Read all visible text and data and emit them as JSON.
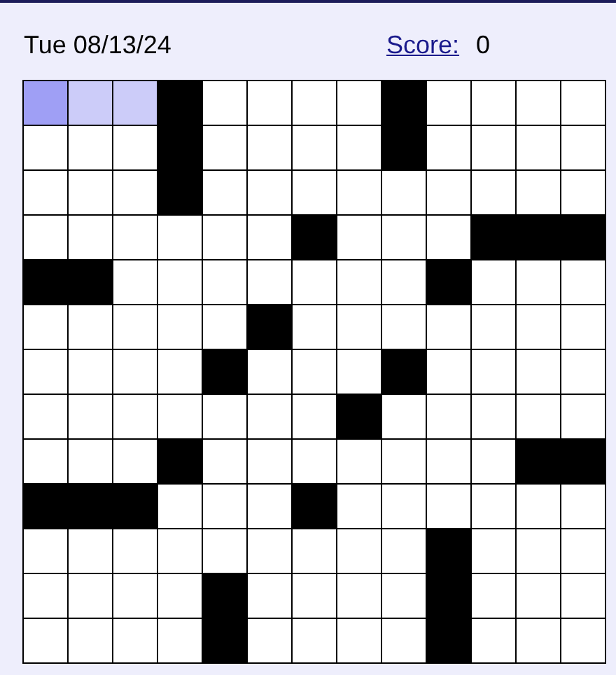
{
  "header": {
    "date": "Tue 08/13/24",
    "score_label": "Score:",
    "score": "0"
  },
  "grid": {
    "rows": [
      {
        "cells": [
          {
            "kind": "open",
            "selected": true,
            "in_word": true
          },
          {
            "kind": "open",
            "selected": false,
            "in_word": true
          },
          {
            "kind": "open",
            "selected": false,
            "in_word": true
          },
          {
            "kind": "block"
          },
          {
            "kind": "open",
            "selected": false,
            "in_word": false
          },
          {
            "kind": "open",
            "selected": false,
            "in_word": false
          },
          {
            "kind": "open",
            "selected": false,
            "in_word": false
          },
          {
            "kind": "open",
            "selected": false,
            "in_word": false
          },
          {
            "kind": "block"
          },
          {
            "kind": "open",
            "selected": false,
            "in_word": false
          },
          {
            "kind": "open",
            "selected": false,
            "in_word": false
          },
          {
            "kind": "open",
            "selected": false,
            "in_word": false
          },
          {
            "kind": "open",
            "selected": false,
            "in_word": false
          }
        ]
      },
      {
        "cells": [
          {
            "kind": "open",
            "selected": false,
            "in_word": false
          },
          {
            "kind": "open",
            "selected": false,
            "in_word": false
          },
          {
            "kind": "open",
            "selected": false,
            "in_word": false
          },
          {
            "kind": "block"
          },
          {
            "kind": "open",
            "selected": false,
            "in_word": false
          },
          {
            "kind": "open",
            "selected": false,
            "in_word": false
          },
          {
            "kind": "open",
            "selected": false,
            "in_word": false
          },
          {
            "kind": "open",
            "selected": false,
            "in_word": false
          },
          {
            "kind": "block"
          },
          {
            "kind": "open",
            "selected": false,
            "in_word": false
          },
          {
            "kind": "open",
            "selected": false,
            "in_word": false
          },
          {
            "kind": "open",
            "selected": false,
            "in_word": false
          },
          {
            "kind": "open",
            "selected": false,
            "in_word": false
          }
        ]
      },
      {
        "cells": [
          {
            "kind": "open",
            "selected": false,
            "in_word": false
          },
          {
            "kind": "open",
            "selected": false,
            "in_word": false
          },
          {
            "kind": "open",
            "selected": false,
            "in_word": false
          },
          {
            "kind": "block"
          },
          {
            "kind": "open",
            "selected": false,
            "in_word": false
          },
          {
            "kind": "open",
            "selected": false,
            "in_word": false
          },
          {
            "kind": "open",
            "selected": false,
            "in_word": false
          },
          {
            "kind": "open",
            "selected": false,
            "in_word": false
          },
          {
            "kind": "open",
            "selected": false,
            "in_word": false
          },
          {
            "kind": "open",
            "selected": false,
            "in_word": false
          },
          {
            "kind": "open",
            "selected": false,
            "in_word": false
          },
          {
            "kind": "open",
            "selected": false,
            "in_word": false
          },
          {
            "kind": "open",
            "selected": false,
            "in_word": false
          }
        ]
      },
      {
        "cells": [
          {
            "kind": "open",
            "selected": false,
            "in_word": false
          },
          {
            "kind": "open",
            "selected": false,
            "in_word": false
          },
          {
            "kind": "open",
            "selected": false,
            "in_word": false
          },
          {
            "kind": "open",
            "selected": false,
            "in_word": false
          },
          {
            "kind": "open",
            "selected": false,
            "in_word": false
          },
          {
            "kind": "open",
            "selected": false,
            "in_word": false
          },
          {
            "kind": "block"
          },
          {
            "kind": "open",
            "selected": false,
            "in_word": false
          },
          {
            "kind": "open",
            "selected": false,
            "in_word": false
          },
          {
            "kind": "open",
            "selected": false,
            "in_word": false
          },
          {
            "kind": "block"
          },
          {
            "kind": "block"
          },
          {
            "kind": "block"
          }
        ]
      },
      {
        "cells": [
          {
            "kind": "block"
          },
          {
            "kind": "block"
          },
          {
            "kind": "open",
            "selected": false,
            "in_word": false
          },
          {
            "kind": "open",
            "selected": false,
            "in_word": false
          },
          {
            "kind": "open",
            "selected": false,
            "in_word": false
          },
          {
            "kind": "open",
            "selected": false,
            "in_word": false
          },
          {
            "kind": "open",
            "selected": false,
            "in_word": false
          },
          {
            "kind": "open",
            "selected": false,
            "in_word": false
          },
          {
            "kind": "open",
            "selected": false,
            "in_word": false
          },
          {
            "kind": "block"
          },
          {
            "kind": "open",
            "selected": false,
            "in_word": false
          },
          {
            "kind": "open",
            "selected": false,
            "in_word": false
          },
          {
            "kind": "open",
            "selected": false,
            "in_word": false
          }
        ]
      },
      {
        "cells": [
          {
            "kind": "open",
            "selected": false,
            "in_word": false
          },
          {
            "kind": "open",
            "selected": false,
            "in_word": false
          },
          {
            "kind": "open",
            "selected": false,
            "in_word": false
          },
          {
            "kind": "open",
            "selected": false,
            "in_word": false
          },
          {
            "kind": "open",
            "selected": false,
            "in_word": false
          },
          {
            "kind": "block"
          },
          {
            "kind": "open",
            "selected": false,
            "in_word": false
          },
          {
            "kind": "open",
            "selected": false,
            "in_word": false
          },
          {
            "kind": "open",
            "selected": false,
            "in_word": false
          },
          {
            "kind": "open",
            "selected": false,
            "in_word": false
          },
          {
            "kind": "open",
            "selected": false,
            "in_word": false
          },
          {
            "kind": "open",
            "selected": false,
            "in_word": false
          },
          {
            "kind": "open",
            "selected": false,
            "in_word": false
          }
        ]
      },
      {
        "cells": [
          {
            "kind": "open",
            "selected": false,
            "in_word": false
          },
          {
            "kind": "open",
            "selected": false,
            "in_word": false
          },
          {
            "kind": "open",
            "selected": false,
            "in_word": false
          },
          {
            "kind": "open",
            "selected": false,
            "in_word": false
          },
          {
            "kind": "block"
          },
          {
            "kind": "open",
            "selected": false,
            "in_word": false
          },
          {
            "kind": "open",
            "selected": false,
            "in_word": false
          },
          {
            "kind": "open",
            "selected": false,
            "in_word": false
          },
          {
            "kind": "block"
          },
          {
            "kind": "open",
            "selected": false,
            "in_word": false
          },
          {
            "kind": "open",
            "selected": false,
            "in_word": false
          },
          {
            "kind": "open",
            "selected": false,
            "in_word": false
          },
          {
            "kind": "open",
            "selected": false,
            "in_word": false
          }
        ]
      },
      {
        "cells": [
          {
            "kind": "open",
            "selected": false,
            "in_word": false
          },
          {
            "kind": "open",
            "selected": false,
            "in_word": false
          },
          {
            "kind": "open",
            "selected": false,
            "in_word": false
          },
          {
            "kind": "open",
            "selected": false,
            "in_word": false
          },
          {
            "kind": "open",
            "selected": false,
            "in_word": false
          },
          {
            "kind": "open",
            "selected": false,
            "in_word": false
          },
          {
            "kind": "open",
            "selected": false,
            "in_word": false
          },
          {
            "kind": "block"
          },
          {
            "kind": "open",
            "selected": false,
            "in_word": false
          },
          {
            "kind": "open",
            "selected": false,
            "in_word": false
          },
          {
            "kind": "open",
            "selected": false,
            "in_word": false
          },
          {
            "kind": "open",
            "selected": false,
            "in_word": false
          },
          {
            "kind": "open",
            "selected": false,
            "in_word": false
          }
        ]
      },
      {
        "cells": [
          {
            "kind": "open",
            "selected": false,
            "in_word": false
          },
          {
            "kind": "open",
            "selected": false,
            "in_word": false
          },
          {
            "kind": "open",
            "selected": false,
            "in_word": false
          },
          {
            "kind": "block"
          },
          {
            "kind": "open",
            "selected": false,
            "in_word": false
          },
          {
            "kind": "open",
            "selected": false,
            "in_word": false
          },
          {
            "kind": "open",
            "selected": false,
            "in_word": false
          },
          {
            "kind": "open",
            "selected": false,
            "in_word": false
          },
          {
            "kind": "open",
            "selected": false,
            "in_word": false
          },
          {
            "kind": "open",
            "selected": false,
            "in_word": false
          },
          {
            "kind": "open",
            "selected": false,
            "in_word": false
          },
          {
            "kind": "block"
          },
          {
            "kind": "block"
          }
        ]
      },
      {
        "cells": [
          {
            "kind": "block"
          },
          {
            "kind": "block"
          },
          {
            "kind": "block"
          },
          {
            "kind": "open",
            "selected": false,
            "in_word": false
          },
          {
            "kind": "open",
            "selected": false,
            "in_word": false
          },
          {
            "kind": "open",
            "selected": false,
            "in_word": false
          },
          {
            "kind": "block"
          },
          {
            "kind": "open",
            "selected": false,
            "in_word": false
          },
          {
            "kind": "open",
            "selected": false,
            "in_word": false
          },
          {
            "kind": "open",
            "selected": false,
            "in_word": false
          },
          {
            "kind": "open",
            "selected": false,
            "in_word": false
          },
          {
            "kind": "open",
            "selected": false,
            "in_word": false
          },
          {
            "kind": "open",
            "selected": false,
            "in_word": false
          }
        ]
      },
      {
        "cells": [
          {
            "kind": "open",
            "selected": false,
            "in_word": false
          },
          {
            "kind": "open",
            "selected": false,
            "in_word": false
          },
          {
            "kind": "open",
            "selected": false,
            "in_word": false
          },
          {
            "kind": "open",
            "selected": false,
            "in_word": false
          },
          {
            "kind": "open",
            "selected": false,
            "in_word": false
          },
          {
            "kind": "open",
            "selected": false,
            "in_word": false
          },
          {
            "kind": "open",
            "selected": false,
            "in_word": false
          },
          {
            "kind": "open",
            "selected": false,
            "in_word": false
          },
          {
            "kind": "open",
            "selected": false,
            "in_word": false
          },
          {
            "kind": "block"
          },
          {
            "kind": "open",
            "selected": false,
            "in_word": false
          },
          {
            "kind": "open",
            "selected": false,
            "in_word": false
          },
          {
            "kind": "open",
            "selected": false,
            "in_word": false
          }
        ]
      },
      {
        "cells": [
          {
            "kind": "open",
            "selected": false,
            "in_word": false
          },
          {
            "kind": "open",
            "selected": false,
            "in_word": false
          },
          {
            "kind": "open",
            "selected": false,
            "in_word": false
          },
          {
            "kind": "open",
            "selected": false,
            "in_word": false
          },
          {
            "kind": "block"
          },
          {
            "kind": "open",
            "selected": false,
            "in_word": false
          },
          {
            "kind": "open",
            "selected": false,
            "in_word": false
          },
          {
            "kind": "open",
            "selected": false,
            "in_word": false
          },
          {
            "kind": "open",
            "selected": false,
            "in_word": false
          },
          {
            "kind": "block"
          },
          {
            "kind": "open",
            "selected": false,
            "in_word": false
          },
          {
            "kind": "open",
            "selected": false,
            "in_word": false
          },
          {
            "kind": "open",
            "selected": false,
            "in_word": false
          }
        ]
      },
      {
        "cells": [
          {
            "kind": "open",
            "selected": false,
            "in_word": false
          },
          {
            "kind": "open",
            "selected": false,
            "in_word": false
          },
          {
            "kind": "open",
            "selected": false,
            "in_word": false
          },
          {
            "kind": "open",
            "selected": false,
            "in_word": false
          },
          {
            "kind": "block"
          },
          {
            "kind": "open",
            "selected": false,
            "in_word": false
          },
          {
            "kind": "open",
            "selected": false,
            "in_word": false
          },
          {
            "kind": "open",
            "selected": false,
            "in_word": false
          },
          {
            "kind": "open",
            "selected": false,
            "in_word": false
          },
          {
            "kind": "block"
          },
          {
            "kind": "open",
            "selected": false,
            "in_word": false
          },
          {
            "kind": "open",
            "selected": false,
            "in_word": false
          },
          {
            "kind": "open",
            "selected": false,
            "in_word": false
          }
        ]
      }
    ]
  }
}
